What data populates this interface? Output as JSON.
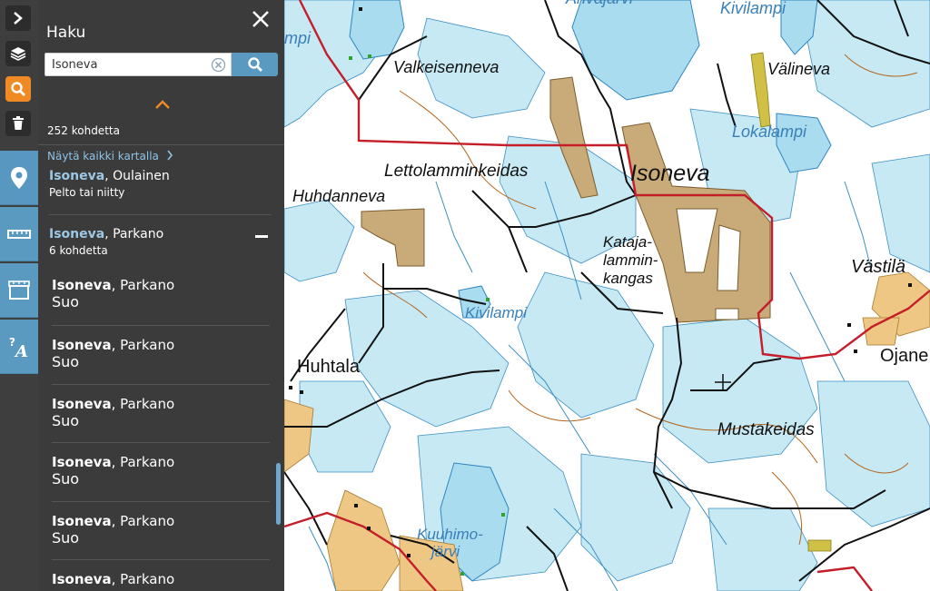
{
  "panel": {
    "title": "Haku",
    "search_value": "Isoneva",
    "result_count": "252 kohdetta",
    "show_all_label": "Näytä kaikki kartalla"
  },
  "results": [
    {
      "name": "Isoneva",
      "place": ", Oulainen",
      "type": "Pelto tai niitty"
    },
    {
      "name": "Isoneva",
      "place": ", Parkano",
      "type": "6 kohdetta"
    }
  ],
  "children": [
    {
      "name": "Isoneva",
      "place": ", Parkano",
      "type": "Suo"
    },
    {
      "name": "Isoneva",
      "place": ", Parkano",
      "type": "Suo"
    },
    {
      "name": "Isoneva",
      "place": ", Parkano",
      "type": "Suo"
    },
    {
      "name": "Isoneva",
      "place": ", Parkano",
      "type": "Suo"
    },
    {
      "name": "Isoneva",
      "place": ", Parkano",
      "type": "Suo"
    },
    {
      "name": "Isoneva",
      "place": ", Parkano",
      "type": ""
    }
  ],
  "map": {
    "labels": {
      "valkeisenneva": "Valkeisenneva",
      "kivilampi_top": "Kivilampi",
      "valineva": "Välineva",
      "lokalampi": "Lokalampi",
      "lettolamminkeidas": "Lettolamminkeidas",
      "isoneva": "Isoneva",
      "huhdanneva": "Huhdanneva",
      "kataja1": "Kataja-",
      "kataja2": "lammin-",
      "kataja3": "kangas",
      "vastila": "Västilä",
      "kivilampi": "Kivilampi",
      "huhtala": "Huhtala",
      "ojane": "Ojane",
      "mustakeidas": "Mustakeidas",
      "kuuhimo1": "Kuuhimo-",
      "kuuhimo2": "järvi",
      "topleft_water": "mpi",
      "top_partial": "Ahvajärvi"
    }
  },
  "colors": {
    "panel_bg": "#3b3b3b",
    "accent_blue": "#5b9ac0",
    "active_orange": "#f08a24",
    "highlight_text": "#9cc8e6",
    "water": "#a9dcef",
    "bog": "#c8ab78",
    "field": "#eec785",
    "road_red": "#c41e2a"
  }
}
